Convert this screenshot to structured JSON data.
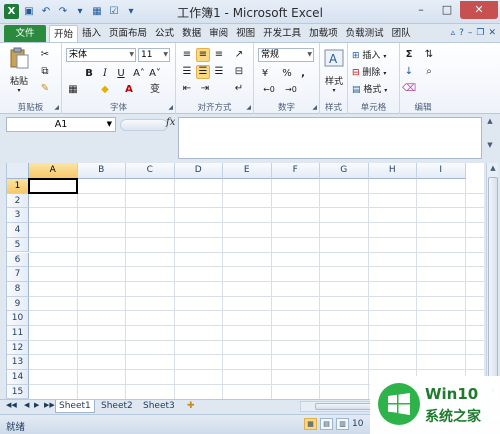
{
  "window": {
    "title": "工作簿1 - Microsoft Excel",
    "controls": {
      "minimize": "–",
      "maximize": "□",
      "close": "✕"
    }
  },
  "quick_access": {
    "logo": "X"
  },
  "ribbon_tabs": [
    "开始",
    "插入",
    "页面布局",
    "公式",
    "数据",
    "审阅",
    "视图",
    "开发工具",
    "加载项",
    "负载测试",
    "团队"
  ],
  "file_tab": "文件",
  "ribbon": {
    "clipboard": {
      "label": "剪贴板",
      "paste": "粘贴"
    },
    "font": {
      "label": "字体",
      "name": "宋体",
      "size": "11",
      "bold": "B",
      "italic": "I",
      "underline": "U",
      "grow": "A˄",
      "shrink": "A˅",
      "wen": "变"
    },
    "alignment": {
      "label": "对齐方式"
    },
    "number": {
      "label": "数字",
      "format": "常规",
      "percent": "%",
      "comma": ","
    },
    "styles": {
      "label": "样式",
      "button": "样式"
    },
    "cells": {
      "label": "单元格",
      "insert": "插入",
      "delete": "删除",
      "format": "格式"
    },
    "editing": {
      "label": "编辑",
      "sum": "Σ"
    }
  },
  "formula_bar": {
    "name_box": "A1",
    "fx": "fx",
    "formula": ""
  },
  "columns": [
    "A",
    "B",
    "C",
    "D",
    "E",
    "F",
    "G",
    "H",
    "I"
  ],
  "rows": [
    "1",
    "2",
    "3",
    "4",
    "5",
    "6",
    "7",
    "8",
    "9",
    "10",
    "11",
    "12",
    "13",
    "14",
    "15"
  ],
  "active_cell": "A1",
  "sheets": [
    "Sheet1",
    "Sheet2",
    "Sheet3"
  ],
  "status": {
    "ready": "就绪",
    "zoom": "10"
  },
  "watermark": {
    "line1": "Win10",
    "line2": "系统之家"
  },
  "colors": {
    "file_tab": "#2a8a3e",
    "selection": "#fbd982",
    "header_active": "#f5c86a"
  }
}
